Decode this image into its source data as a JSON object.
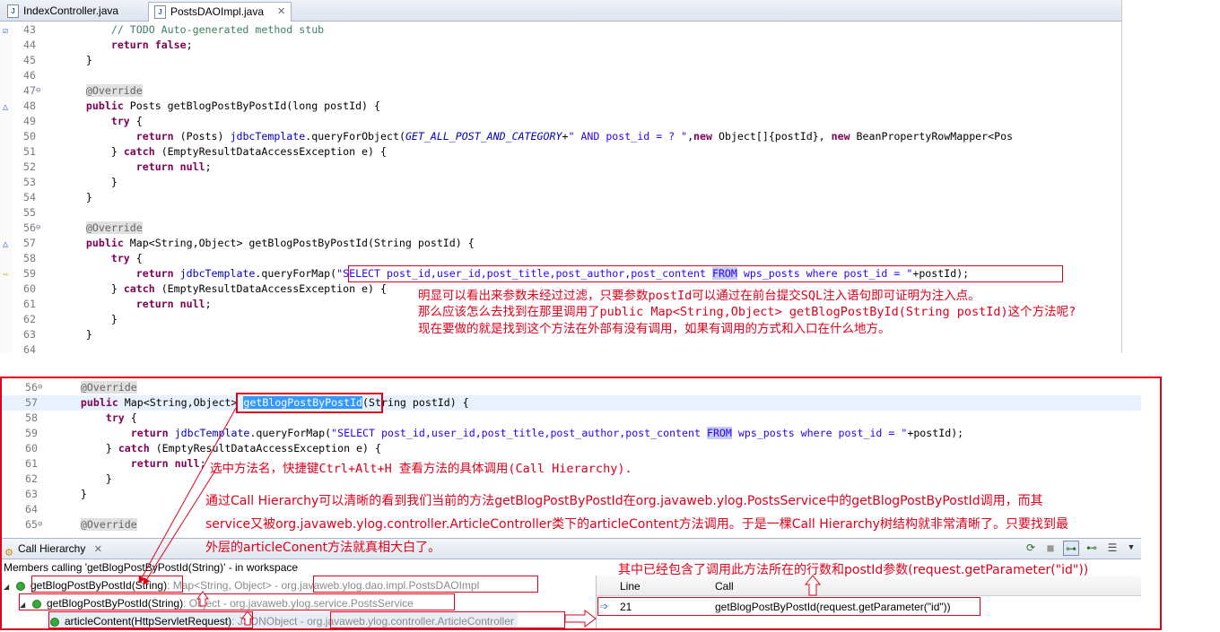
{
  "tabs": [
    {
      "label": "IndexController.java"
    },
    {
      "label": "PostsDAOImpl.java"
    }
  ],
  "top_code": [
    {
      "ln": "43",
      "text": "        // TODO Auto-generated method stub"
    },
    {
      "ln": "44",
      "text": "        return false;"
    },
    {
      "ln": "45",
      "text": "    }"
    },
    {
      "ln": "46",
      "text": ""
    },
    {
      "ln": "47",
      "text": "    @Override"
    },
    {
      "ln": "48",
      "text": "    public Posts getBlogPostByPostId(long postId) {"
    },
    {
      "ln": "49",
      "text": "        try {"
    },
    {
      "ln": "50",
      "text": "            return (Posts) jdbcTemplate.queryForObject(GET_ALL_POST_AND_CATEGORY+\" AND post_id = ? \",new Object[]{postId}, new BeanPropertyRowMapper<Pos"
    },
    {
      "ln": "51",
      "text": "        } catch (EmptyResultDataAccessException e) {"
    },
    {
      "ln": "52",
      "text": "            return null;"
    },
    {
      "ln": "53",
      "text": "        }"
    },
    {
      "ln": "54",
      "text": "    }"
    },
    {
      "ln": "55",
      "text": ""
    },
    {
      "ln": "56",
      "text": "    @Override"
    },
    {
      "ln": "57",
      "text": "    public Map<String,Object> getBlogPostByPostId(String postId) {"
    },
    {
      "ln": "58",
      "text": "        try {"
    },
    {
      "ln": "59",
      "text": "            return jdbcTemplate.queryForMap(\"SELECT post_id,user_id,post_title,post_author,post_content FROM wps_posts where post_id = \"+postId);"
    },
    {
      "ln": "60",
      "text": "        } catch (EmptyResultDataAccessException e) {"
    },
    {
      "ln": "61",
      "text": "            return null;"
    },
    {
      "ln": "62",
      "text": "        }"
    },
    {
      "ln": "63",
      "text": "    }"
    },
    {
      "ln": "64",
      "text": ""
    }
  ],
  "annotation_top": [
    "明显可以看出来参数未经过过滤，只要参数postId可以通过在前台提交SQL注入语句即可证明为注入点。",
    "那么应该怎么去找到在那里调用了public Map<String,Object> getBlogPostById(String postId)这个方法呢?",
    "现在要做的就是找到这个方法在外部有没有调用，如果有调用的方式和入口在什么地方。"
  ],
  "bottom_code": [
    {
      "ln": "56",
      "text": "    @Override"
    },
    {
      "ln": "57",
      "text": "    public Map<String,Object> getBlogPostByPostId(String postId) {"
    },
    {
      "ln": "58",
      "text": "        try {"
    },
    {
      "ln": "59",
      "text": "            return jdbcTemplate.queryForMap(\"SELECT post_id,user_id,post_title,post_author,post_content FROM wps_posts where post_id = \"+postId);"
    },
    {
      "ln": "60",
      "text": "        } catch (EmptyResultDataAccessException e) {"
    },
    {
      "ln": "61",
      "text": "            return null;"
    },
    {
      "ln": "62",
      "text": "        }"
    },
    {
      "ln": "63",
      "text": "    }"
    },
    {
      "ln": "64",
      "text": ""
    },
    {
      "ln": "65",
      "text": "    @Override"
    }
  ],
  "annotation_select": "选中方法名，快捷键Ctrl+Alt+H 查看方法的具体调用(Call Hierarchy).",
  "annotation_explain": [
    "通过Call Hierarchy可以清晰的看到我们当前的方法getBlogPostByPostId在org.javaweb.ylog.PostsService中的getBlogPostByPostId调用，而其",
    "service又被org.javaweb.ylog.controller.ArticleController类下的articleContent方法调用。于是一棵Call Hierarchy树结构就非常清晰了。只要找到最",
    "外层的articleConent方法就真相大白了。"
  ],
  "annotation_line": "其中已经包含了调用此方法所在的行数和postId参数(request.getParameter(\"id\"))",
  "call_hierarchy": {
    "title": "Call Hierarchy",
    "members_label": "Members calling 'getBlogPostByPostId(String)' - in workspace",
    "tree": [
      {
        "method": "getBlogPostByPostId(String)",
        "type": ": Map<String, Object> - ",
        "owner": "org.javaweb.ylog.dao.impl.PostsDAOImpl"
      },
      {
        "method": "getBlogPostByPostId(String)",
        "type": ": Object - ",
        "owner": "org.javaweb.ylog.service.PostsService"
      },
      {
        "method": "articleContent(HttpServletRequest)",
        "type": ": JSONObject - ",
        "owner": "org.javaweb.ylog.controller.ArticleController"
      }
    ],
    "table": {
      "col_line": "Line",
      "col_call": "Call",
      "rows": [
        {
          "line": "21",
          "call": "getBlogPostByPostId(request.getParameter(\"id\"))"
        }
      ]
    }
  }
}
